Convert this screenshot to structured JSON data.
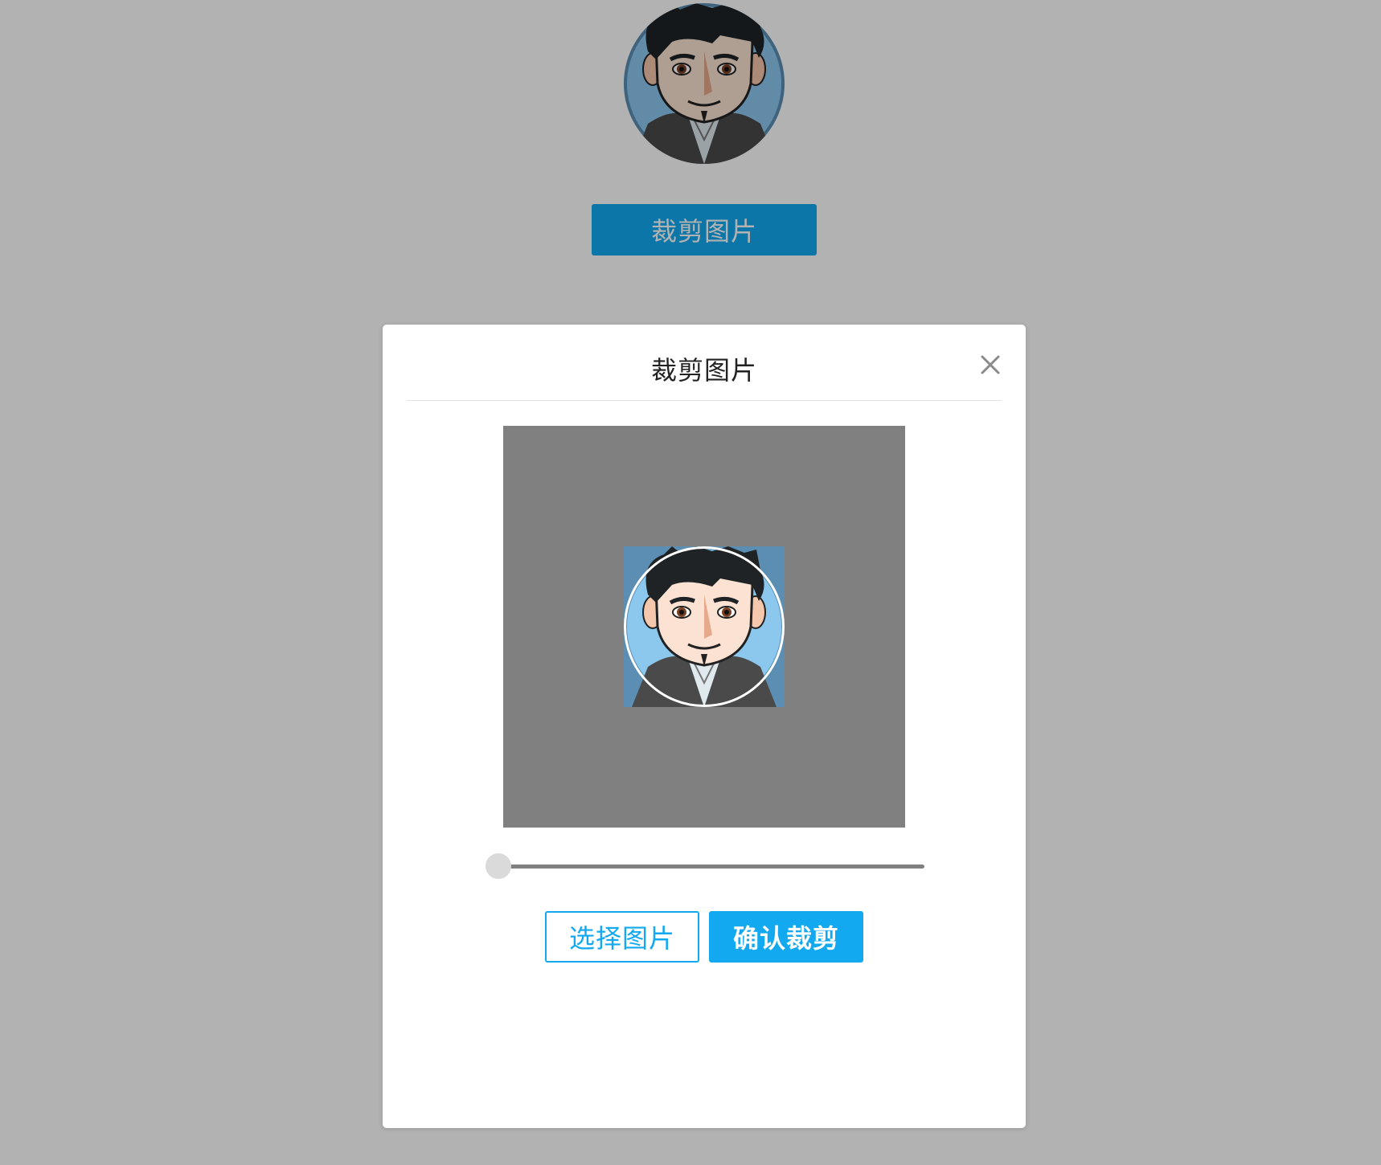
{
  "page": {
    "avatar_alt": "avatar",
    "crop_button_label": "裁剪图片"
  },
  "dialog": {
    "title": "裁剪图片",
    "close_icon": "close-icon",
    "zoom_level": 0.0,
    "select_image_label": "选择图片",
    "confirm_crop_label": "确认裁剪"
  },
  "colors": {
    "accent": "#12a9f1",
    "stage": "#808080",
    "overlay": "rgba(0,0,0,0.3)"
  }
}
